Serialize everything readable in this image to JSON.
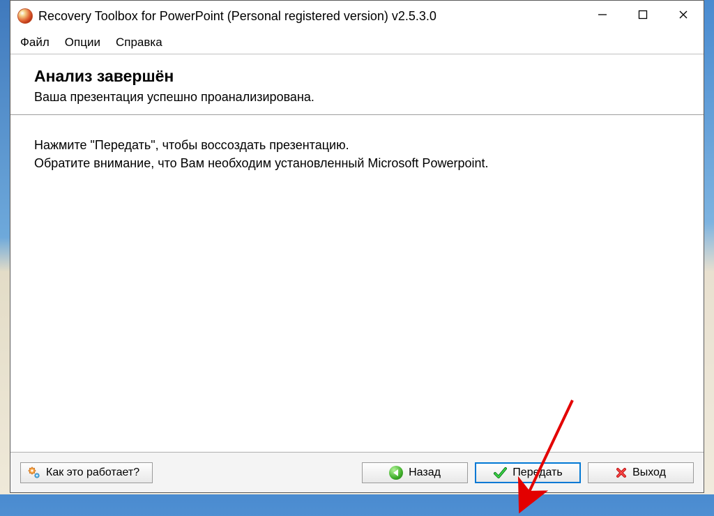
{
  "window": {
    "title": "Recovery Toolbox for PowerPoint (Personal registered version) v2.5.3.0"
  },
  "menu": {
    "file": "Файл",
    "options": "Опции",
    "help": "Справка"
  },
  "header": {
    "title": "Анализ завершён",
    "subtitle": "Ваша презентация успешно проанализирована."
  },
  "body": {
    "line1": "Нажмите \"Передать\", чтобы воссоздать презентацию.",
    "line2": "Обратите внимание, что Вам необходим установленный Microsoft Powerpoint."
  },
  "footer": {
    "help_button": "Как это работает?",
    "back_button": "Назад",
    "transmit_button": "Передать",
    "exit_button": "Выход"
  }
}
